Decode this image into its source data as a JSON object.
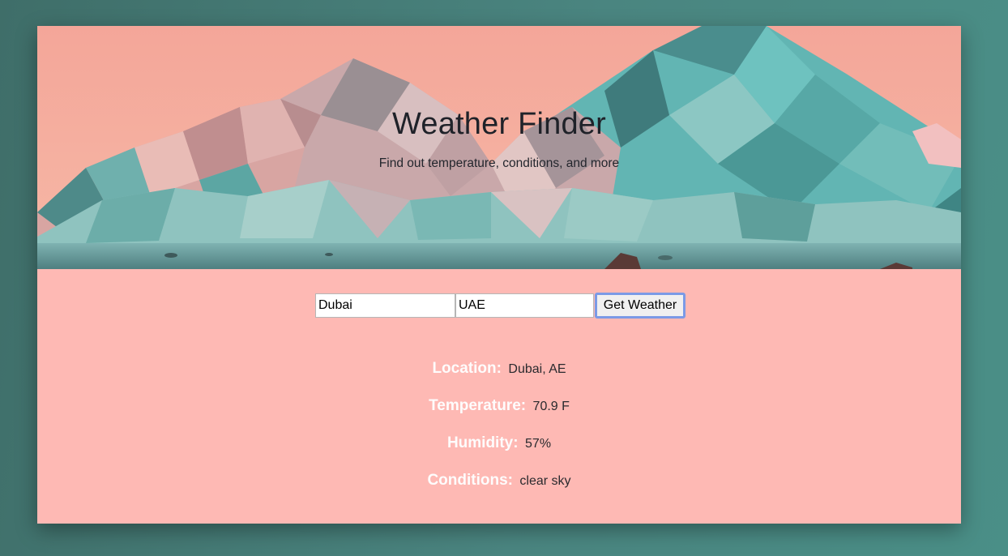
{
  "header": {
    "title": "Weather Finder",
    "subtitle": "Find out temperature, conditions, and more"
  },
  "form": {
    "city_value": "Dubai",
    "country_value": "UAE",
    "submit_label": "Get Weather"
  },
  "results": {
    "location_label": "Location:",
    "location_value": "Dubai, AE",
    "temperature_label": "Temperature:",
    "temperature_value": "70.9 F",
    "humidity_label": "Humidity:",
    "humidity_value": "57%",
    "conditions_label": "Conditions:",
    "conditions_value": "clear sky"
  },
  "colors": {
    "page_background": "#4a8580",
    "card_background": "#feb9b4",
    "sky": "#f5a89a",
    "mountain_teal": "#5fb3b0",
    "label_text": "#ffffff",
    "button_focus_border": "#7b9ae6"
  }
}
